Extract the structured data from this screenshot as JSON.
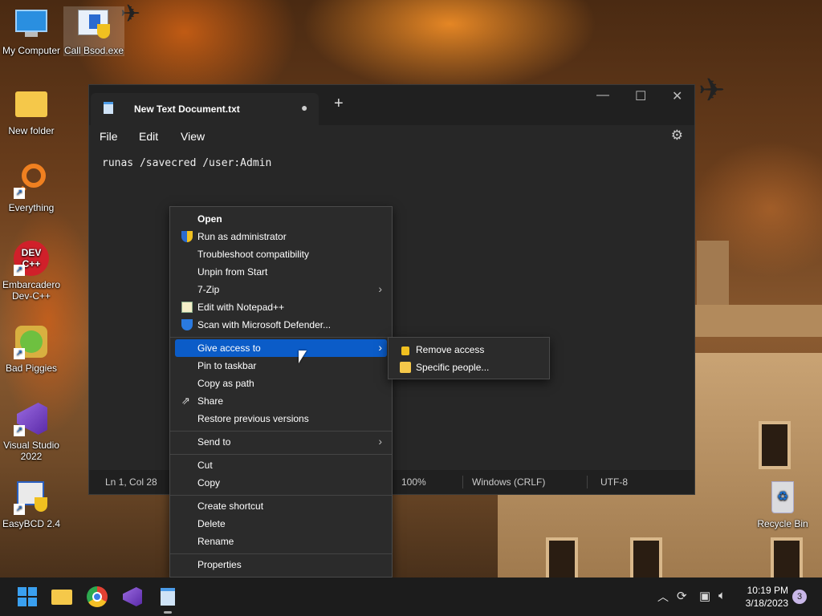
{
  "desktop": {
    "icons": [
      {
        "label": "My Computer"
      },
      {
        "label": "Call Bsod.exe"
      },
      {
        "label": "New folder"
      },
      {
        "label": "Everything"
      },
      {
        "label": "Embarcadero Dev-C++"
      },
      {
        "label": "Bad Piggies"
      },
      {
        "label": "Visual Studio 2022"
      },
      {
        "label": "EasyBCD 2.4"
      },
      {
        "label": "Recycle Bin"
      }
    ],
    "devcpp_logo": "DEV C++"
  },
  "notepad": {
    "tab_title": "New Text Document.txt",
    "tab_modified": "●",
    "new_tab": "+",
    "controls": {
      "minimize": "—",
      "maximize": "☐",
      "close": "✕"
    },
    "menus": [
      "File",
      "Edit",
      "View"
    ],
    "content": "runas /savecred /user:Admin",
    "status": {
      "position": "Ln 1, Col 28",
      "zoom": "100%",
      "line_ending": "Windows (CRLF)",
      "encoding": "UTF-8"
    }
  },
  "context_menu": {
    "items": [
      {
        "label": "Open"
      },
      {
        "label": "Run as administrator"
      },
      {
        "label": "Troubleshoot compatibility"
      },
      {
        "label": "Unpin from Start"
      },
      {
        "label": "7-Zip"
      },
      {
        "label": "Edit with Notepad++"
      },
      {
        "label": "Scan with Microsoft Defender..."
      },
      {
        "label": "Give access to"
      },
      {
        "label": "Pin to taskbar"
      },
      {
        "label": "Copy as path"
      },
      {
        "label": "Share"
      },
      {
        "label": "Restore previous versions"
      },
      {
        "label": "Send to"
      },
      {
        "label": "Cut"
      },
      {
        "label": "Copy"
      },
      {
        "label": "Create shortcut"
      },
      {
        "label": "Delete"
      },
      {
        "label": "Rename"
      },
      {
        "label": "Properties"
      }
    ]
  },
  "submenu": {
    "items": [
      {
        "label": "Remove access"
      },
      {
        "label": "Specific people..."
      }
    ]
  },
  "taskbar": {
    "clock_time": "10:19 PM",
    "clock_date": "3/18/2023",
    "notification_count": "3",
    "tray_chevron": "︿"
  },
  "colors": {
    "accent": "#0b5cc8",
    "notepad_bg": "#272727",
    "taskbar_bg": "#1c1c1c"
  }
}
